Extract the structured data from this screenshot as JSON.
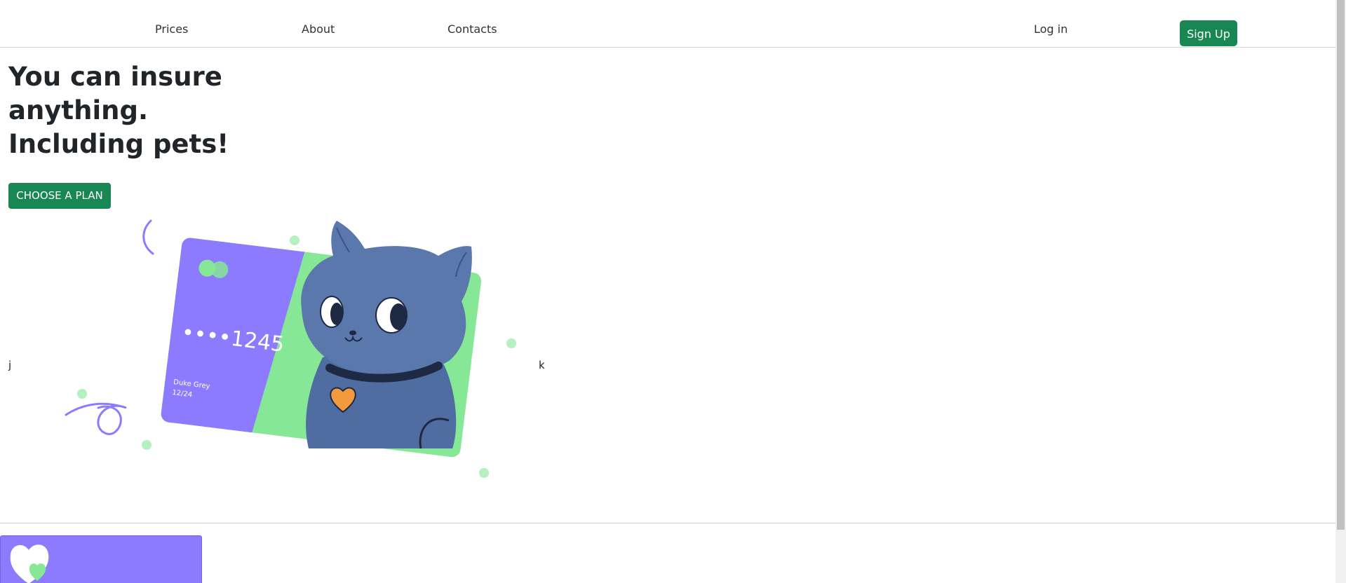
{
  "nav": {
    "prices": "Prices",
    "about": "About",
    "contacts": "Contacts",
    "login": "Log in",
    "signup": "Sign Up"
  },
  "hero": {
    "title_lines": [
      "You can insure",
      "anything.",
      "Including pets!"
    ],
    "cta": "CHOOSE A PLAN",
    "carousel_prev": "j",
    "carousel_next": "k"
  },
  "card": {
    "number": "••••1245",
    "holder": "Duke Grey",
    "expiry": "12/24"
  },
  "colors": {
    "accent_green": "#198754",
    "card_purple": "#8c7bff",
    "card_green": "#86e896",
    "cat_blue": "#4f6da0"
  }
}
